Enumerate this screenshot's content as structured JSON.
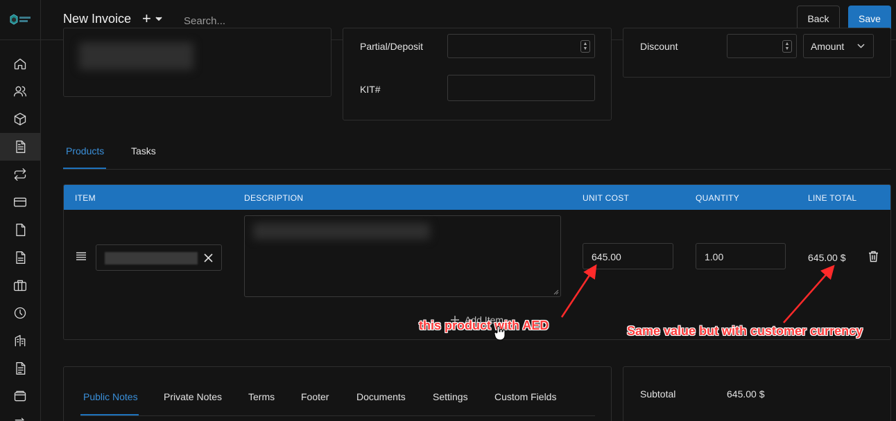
{
  "topbar": {
    "title": "New Invoice",
    "plus_glyph": "+",
    "search_placeholder": "Search...",
    "back_label": "Back",
    "save_label": "Save"
  },
  "sidebar": {
    "items": [
      {
        "icon": "home-icon"
      },
      {
        "icon": "users-icon"
      },
      {
        "icon": "box-icon"
      },
      {
        "icon": "invoice-icon",
        "active": true
      },
      {
        "icon": "recurring-icon"
      },
      {
        "icon": "credit-card-icon"
      },
      {
        "icon": "file-icon"
      },
      {
        "icon": "document-icon"
      },
      {
        "icon": "briefcase-icon"
      },
      {
        "icon": "clock-icon"
      },
      {
        "icon": "building-icon"
      },
      {
        "icon": "receipt-icon"
      },
      {
        "icon": "wallet-icon"
      },
      {
        "icon": "transfer-icon"
      }
    ]
  },
  "details": {
    "partial_label": "Partial/Deposit",
    "partial_value": "",
    "kit_label": "KIT#",
    "kit_value": ""
  },
  "discount": {
    "label": "Discount",
    "value": "",
    "type_selected": "Amount"
  },
  "tabs": {
    "products": "Products",
    "tasks": "Tasks"
  },
  "table": {
    "headers": {
      "item": "ITEM",
      "description": "DESCRIPTION",
      "unit_cost": "UNIT COST",
      "quantity": "QUANTITY",
      "line_total": "LINE TOTAL"
    },
    "rows": [
      {
        "unit_cost": "645.00",
        "quantity": "1.00",
        "line_total": "645.00 $"
      }
    ],
    "add_item_label": "Add Item"
  },
  "annotations": {
    "left": "this product with AED",
    "right": "Same value but with customer currency"
  },
  "bottom_tabs": {
    "public_notes": "Public Notes",
    "private_notes": "Private Notes",
    "terms": "Terms",
    "footer": "Footer",
    "documents": "Documents",
    "settings": "Settings",
    "custom_fields": "Custom Fields"
  },
  "totals": {
    "subtotal_label": "Subtotal",
    "subtotal_value": "645.00 $"
  },
  "colors": {
    "accent": "#1e73be",
    "background": "#141414",
    "annotation": "#ff3a3a"
  }
}
